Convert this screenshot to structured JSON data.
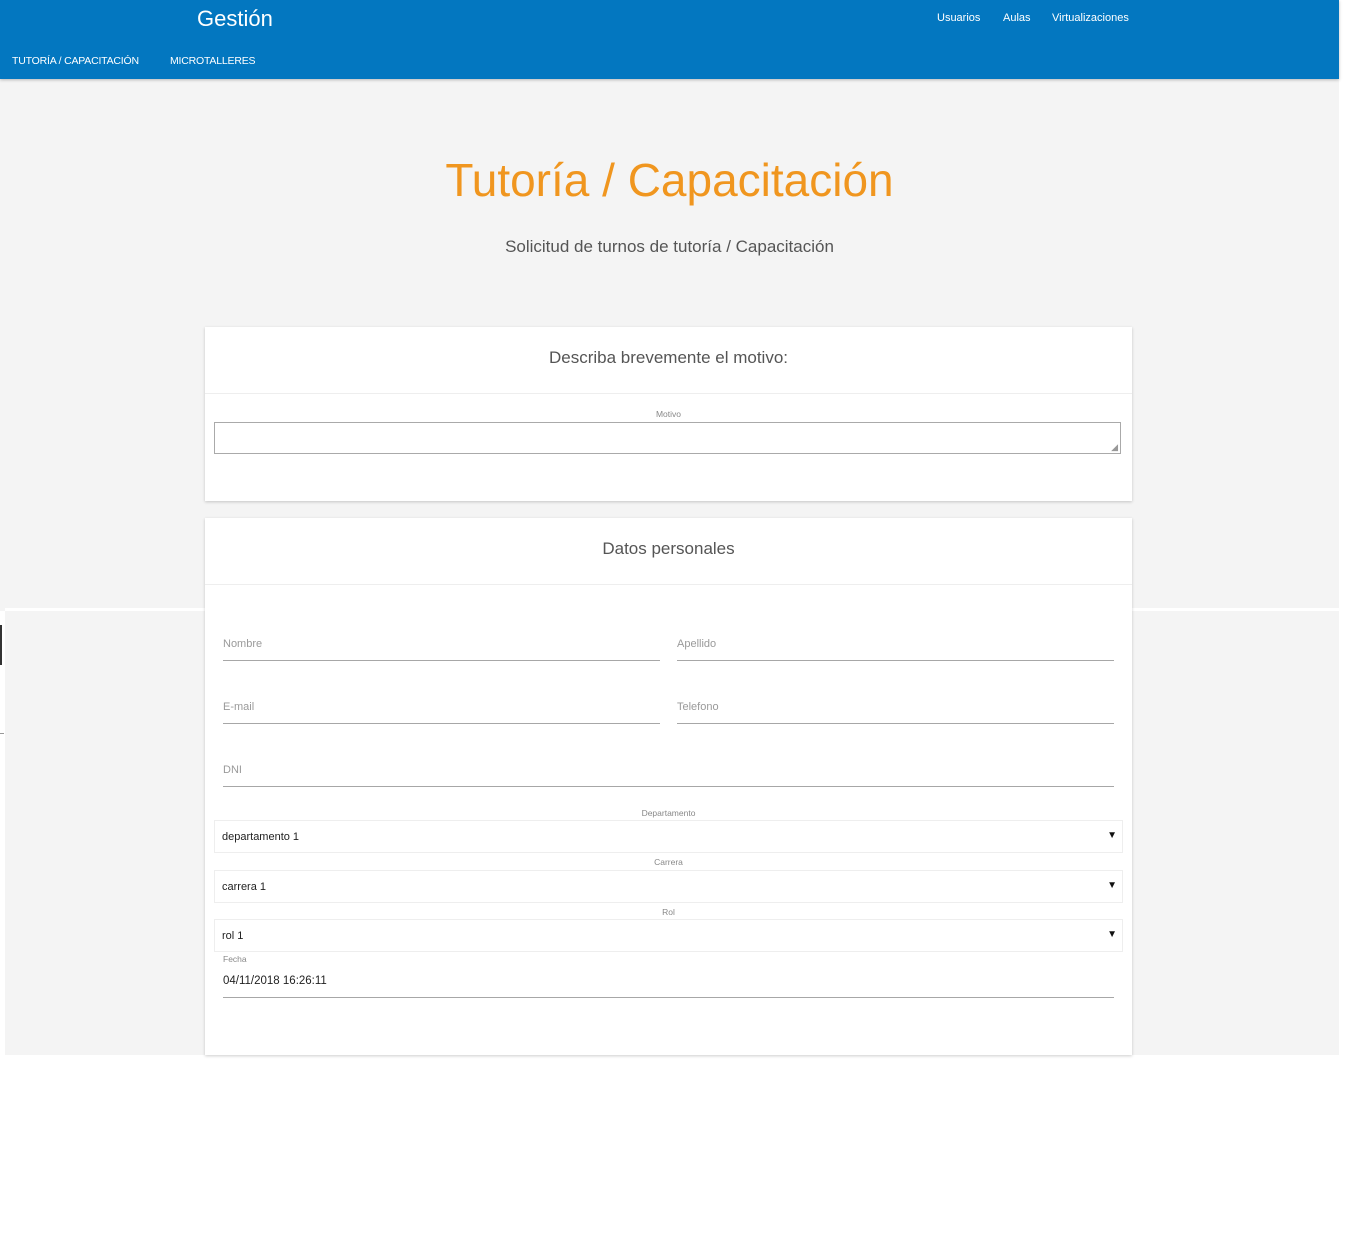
{
  "header": {
    "brand": "Gestión",
    "nav": [
      "Usuarios",
      "Aulas",
      "Virtualizaciones"
    ],
    "subnav": [
      "TUTORÍA / CAPACITACIÓN",
      "MICROTALLERES"
    ]
  },
  "page": {
    "title": "Tutoría / Capacitación",
    "subtitle": "Solicitud de turnos de tutoría / Capacitación"
  },
  "motivo_card": {
    "heading": "Describa brevemente el motivo:",
    "field_label": "Motivo",
    "value": ""
  },
  "personal_card": {
    "heading": "Datos personales",
    "fields": {
      "nombre": "Nombre",
      "apellido": "Apellido",
      "email": "E-mail",
      "telefono": "Telefono",
      "dni": "DNI"
    },
    "selects": {
      "departamento": {
        "label": "Departamento",
        "value": "departamento 1"
      },
      "carrera": {
        "label": "Carrera",
        "value": "carrera 1"
      },
      "rol": {
        "label": "Rol",
        "value": "rol 1"
      }
    },
    "fecha": {
      "label": "Fecha",
      "value": "04/11/2018 16:26:11"
    }
  },
  "colors": {
    "topbar": "#0377c0",
    "accent": "#f0961f",
    "background": "#f4f4f4"
  },
  "icons": {
    "select_arrow": "caret-down-icon",
    "resize": "resize-grip-icon"
  }
}
